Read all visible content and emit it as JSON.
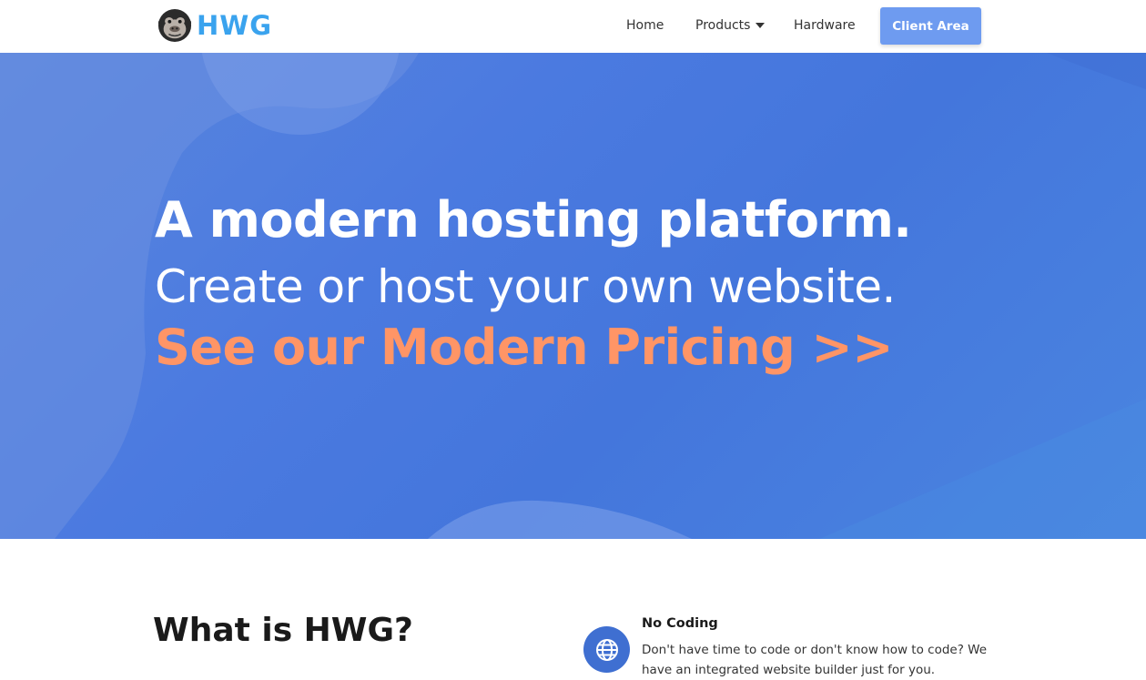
{
  "brand": {
    "logo_text": "HWG",
    "logo_icon": "gorilla-icon",
    "accent": "#3aa3ee"
  },
  "nav": {
    "home": "Home",
    "products": "Products",
    "hardware": "Hardware",
    "client_area": "Client Area",
    "client_area_color": "#6e9bf0"
  },
  "hero": {
    "headline": "A modern hosting platform.",
    "subheadline": "Create or host your own website.",
    "cta": "See our Modern Pricing >>",
    "background": "#4b7ae0",
    "cta_color": "#ff9566"
  },
  "about": {
    "title": "What is HWG?"
  },
  "features": [
    {
      "icon": "globe-icon",
      "title": "No Coding",
      "description": "Don't have time to code or don't know how to code? We have an integrated website builder just for you."
    }
  ]
}
